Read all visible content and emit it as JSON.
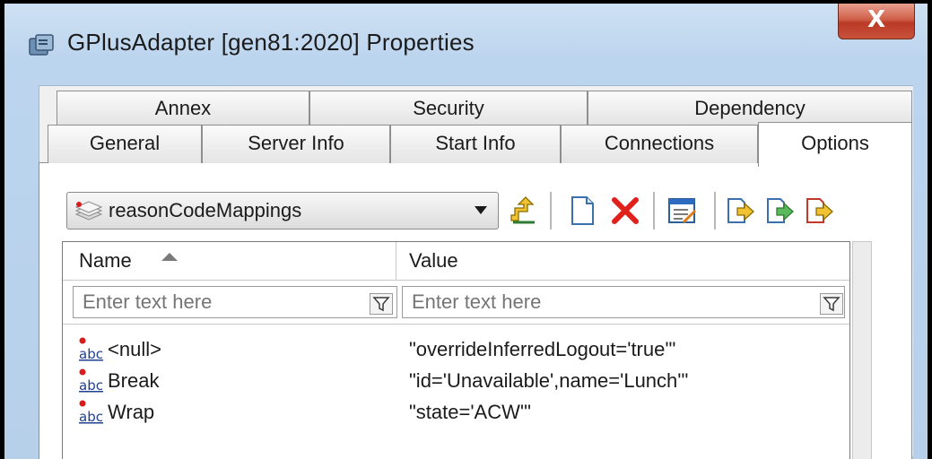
{
  "window": {
    "title": "GPlusAdapter [gen81:2020] Properties",
    "close_label": "X"
  },
  "tabs": {
    "row1": [
      "Annex",
      "Security",
      "Dependency"
    ],
    "row2": [
      "General",
      "Server Info",
      "Start Info",
      "Connections",
      "Options"
    ],
    "active": "Options"
  },
  "section_combo": {
    "selected": "reasonCodeMappings"
  },
  "toolbar": {
    "icons": [
      "up-level-icon",
      "new-document-icon",
      "delete-icon",
      "edit-icon",
      "import-icon",
      "export-icon",
      "copy-icon"
    ]
  },
  "grid": {
    "columns": [
      "Name",
      "Value"
    ],
    "filter_placeholder": "Enter text here",
    "rows": [
      {
        "name": "<null>",
        "value": "\"overrideInferredLogout='true'\""
      },
      {
        "name": "Break",
        "value": "\"id='Unavailable',name='Lunch'\""
      },
      {
        "name": "Wrap",
        "value": "\"state='ACW'\""
      }
    ]
  },
  "colors": {
    "window_frame": "#bcd5ee",
    "close_button": "#c9523b",
    "delete_icon": "#e0201a"
  }
}
